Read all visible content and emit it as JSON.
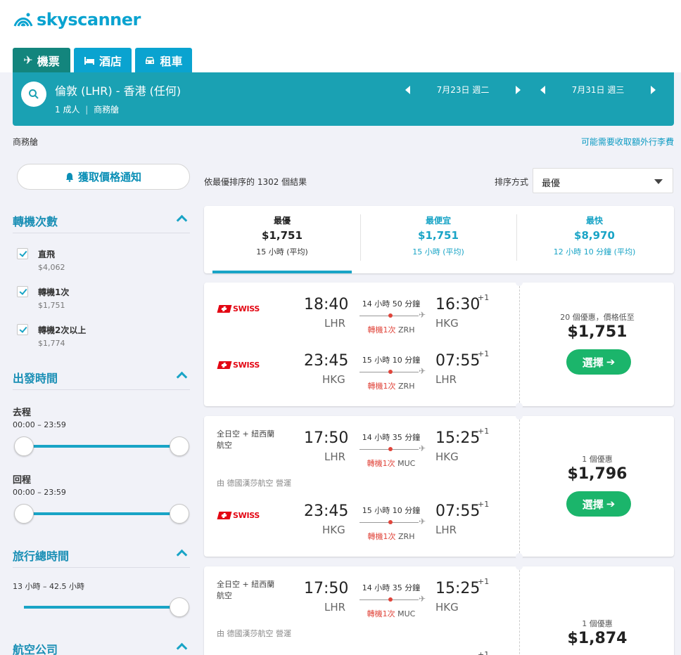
{
  "brand": {
    "name": "skyscanner",
    "color": "#0aa3d0"
  },
  "tabs": [
    {
      "label": "機票",
      "icon": "plane-icon",
      "active": true
    },
    {
      "label": "酒店",
      "icon": "bed-icon",
      "active": false
    },
    {
      "label": "租車",
      "icon": "car-icon",
      "active": false
    }
  ],
  "search": {
    "route": "倫敦 (LHR) - 香港 (任何)",
    "passengers": "1 成人",
    "cabin": "商務艙",
    "depart_date": "7月23日 週二",
    "return_date": "7月31日 週三"
  },
  "cabin_label": "商務艙",
  "baggage_note": "可能需要收取額外行李費",
  "price_alert": "獲取價格通知",
  "results_summary": "依最優排序的 1302 個結果",
  "sort": {
    "label": "排序方式",
    "value": "最優"
  },
  "filters": {
    "stops": {
      "title": "轉機次數",
      "options": [
        {
          "label": "直飛",
          "price": "$4,062"
        },
        {
          "label": "轉機1次",
          "price": "$1,751"
        },
        {
          "label": "轉機2次以上",
          "price": "$1,774"
        }
      ]
    },
    "depart_time": {
      "title": "出發時間",
      "outbound": {
        "label": "去程",
        "range": "00:00 – 23:59"
      },
      "inbound": {
        "label": "回程",
        "range": "00:00 – 23:59"
      }
    },
    "duration": {
      "title": "旅行總時間",
      "range": "13 小時 – 42.5 小時"
    },
    "airlines": {
      "title": "航空公司"
    }
  },
  "sort_tabs": [
    {
      "title": "最優",
      "price": "$1,751",
      "duration": "15 小時 (平均)",
      "active": true
    },
    {
      "title": "最便宜",
      "price": "$1,751",
      "duration": "15 小時 (平均)",
      "active": false
    },
    {
      "title": "最快",
      "price": "$8,970",
      "duration": "12 小時 10 分鐘 (平均)",
      "active": false
    }
  ],
  "results": [
    {
      "legs": [
        {
          "airline": "SWISS",
          "dep": "18:40",
          "dep_code": "LHR",
          "arr": "16:30",
          "arr_code": "HKG",
          "plus": "+1",
          "duration": "14 小時 50 分鐘",
          "stops": "轉機1次",
          "via": "ZRH"
        },
        {
          "airline": "SWISS",
          "dep": "23:45",
          "dep_code": "HKG",
          "arr": "07:55",
          "arr_code": "LHR",
          "plus": "+1",
          "duration": "15 小時 10 分鐘",
          "stops": "轉機1次",
          "via": "ZRH"
        }
      ],
      "deals": "20 個優惠，價格低至",
      "price": "$1,751",
      "select": "選擇"
    },
    {
      "legs": [
        {
          "airline_line1": "全日空 + 紐西蘭",
          "airline_line2": "航空",
          "dep": "17:50",
          "dep_code": "LHR",
          "arr": "15:25",
          "arr_code": "HKG",
          "plus": "+1",
          "duration": "14 小時 35 分鐘",
          "stops": "轉機1次",
          "via": "MUC",
          "operated": "由 德國漢莎航空 營運"
        },
        {
          "airline": "SWISS",
          "dep": "23:45",
          "dep_code": "HKG",
          "arr": "07:55",
          "arr_code": "LHR",
          "plus": "+1",
          "duration": "15 小時 10 分鐘",
          "stops": "轉機1次",
          "via": "ZRH"
        }
      ],
      "deals": "1 個優惠",
      "price": "$1,796",
      "select": "選擇"
    },
    {
      "legs": [
        {
          "airline_line1": "全日空 + 紐西蘭",
          "airline_line2": "航空",
          "dep": "17:50",
          "dep_code": "LHR",
          "arr": "15:25",
          "arr_code": "HKG",
          "plus": "+1",
          "duration": "14 小時 35 分鐘",
          "stops": "轉機1次",
          "via": "MUC",
          "operated": "由 德國漢莎航空 營運"
        },
        {
          "plus": "+1"
        }
      ],
      "deals": "1 個優惠",
      "price": "$1,874"
    }
  ]
}
